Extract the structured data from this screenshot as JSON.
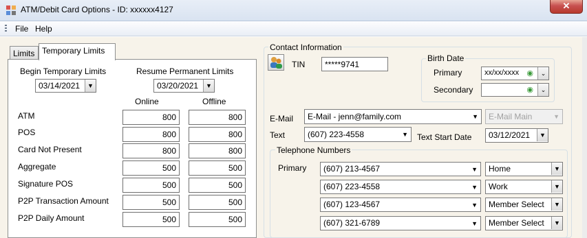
{
  "window": {
    "title": "ATM/Debit Card Options - ID: xxxxxx4127",
    "close_glyph": "✕"
  },
  "menu": {
    "items": [
      "File",
      "Help"
    ]
  },
  "tabs": [
    {
      "label": "Limits",
      "active": false
    },
    {
      "label": "Temporary Limits",
      "active": true
    }
  ],
  "temporary_limits": {
    "begin_label": "Begin Temporary Limits",
    "begin_date": "03/14/2021",
    "resume_label": "Resume Permanent Limits",
    "resume_date": "03/20/2021",
    "col_online": "Online",
    "col_offline": "Offline",
    "rows": [
      {
        "label": "ATM",
        "online": "800",
        "offline": "800"
      },
      {
        "label": "POS",
        "online": "800",
        "offline": "800"
      },
      {
        "label": "Card Not Present",
        "online": "800",
        "offline": "800"
      },
      {
        "label": "Aggregate",
        "online": "500",
        "offline": "500"
      },
      {
        "label": "Signature POS",
        "online": "500",
        "offline": "500"
      },
      {
        "label": "P2P Transaction Amount",
        "online": "500",
        "offline": "500"
      },
      {
        "label": "P2P Daily Amount",
        "online": "500",
        "offline": "500"
      }
    ]
  },
  "contact": {
    "group_title": "Contact Information",
    "tin_label": "TIN",
    "tin_value": "*****9741",
    "birth_date": {
      "group_title": "Birth Date",
      "primary_label": "Primary",
      "primary_value": "xx/xx/xxxx",
      "secondary_label": "Secondary",
      "secondary_value": ""
    },
    "email_label": "E-Mail",
    "email_value": "E-Mail - jenn@family.com",
    "email_type": "E-Mail Main",
    "text_label": "Text",
    "text_value": "(607) 223-4558",
    "text_start_label": "Text Start Date",
    "text_start_date": "03/12/2021",
    "telephone": {
      "group_title": "Telephone Numbers",
      "primary_label": "Primary",
      "numbers": [
        {
          "number": "(607) 213-4567",
          "type": "Home"
        },
        {
          "number": "(607) 223-4558",
          "type": "Work"
        },
        {
          "number": "(607) 123-4567",
          "type": "Member Select"
        },
        {
          "number": "(607) 321-6789",
          "type": "Member Select"
        }
      ]
    }
  },
  "icons": {
    "app": "app-icon",
    "close": "close-icon",
    "contact": "contacts-icon",
    "eye": "eye-icon",
    "dropdown": "chevron-down-icon"
  },
  "colors": {
    "body_bg": "#f7f3ea",
    "close_red": "#c75050",
    "eye_green": "#3a9a3a"
  }
}
